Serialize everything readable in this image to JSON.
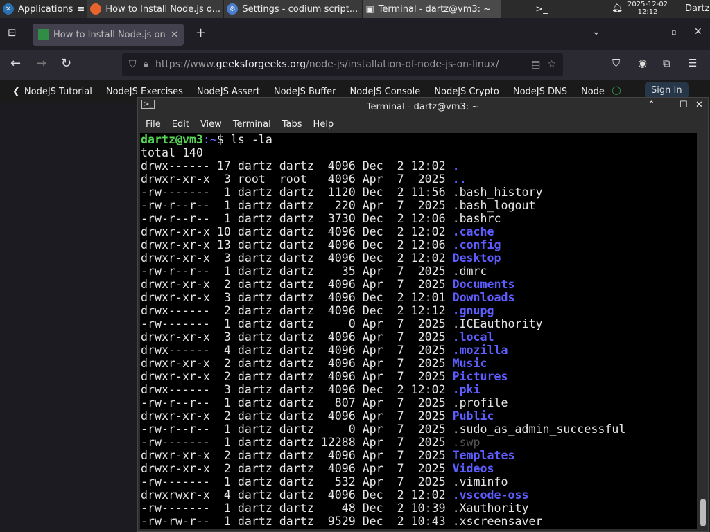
{
  "taskbar": {
    "apps_label": "Applications",
    "windows": [
      "How to Install Node.js o...",
      "Settings - codium script...",
      "Terminal - dartz@vm3: ~"
    ],
    "date": "2025-12-02",
    "time": "12:12",
    "user": "Dartz"
  },
  "browser": {
    "tab_title": "How to Install Node.js on",
    "url_prefix": "https://www.",
    "url_domain": "geeksforgeeks.org",
    "url_path": "/node-js/installation-of-node-js-on-linux/",
    "bookmarks": [
      "NodeJS Tutorial",
      "NodeJS Exercises",
      "NodeJS Assert",
      "NodeJS Buffer",
      "NodeJS Console",
      "NodeJS Crypto",
      "NodeJS DNS",
      "Node"
    ],
    "sign_in": "Sign In"
  },
  "terminal": {
    "title": "Terminal - dartz@vm3: ~",
    "menu": [
      "File",
      "Edit",
      "View",
      "Terminal",
      "Tabs",
      "Help"
    ],
    "prompt_user": "dartz@vm3",
    "prompt_path": ":~",
    "prompt_sym": "$ ",
    "command": "ls -la",
    "total": "total 140",
    "entries": [
      {
        "meta": "drwx------ 17 dartz dartz  4096 Dec  2 12:02 ",
        "name": ".",
        "type": "dir"
      },
      {
        "meta": "drwxr-xr-x  3 root  root   4096 Apr  7  2025 ",
        "name": "..",
        "type": "dir"
      },
      {
        "meta": "-rw-------  1 dartz dartz  1120 Dec  2 11:56 ",
        "name": ".bash_history",
        "type": "file"
      },
      {
        "meta": "-rw-r--r--  1 dartz dartz   220 Apr  7  2025 ",
        "name": ".bash_logout",
        "type": "file"
      },
      {
        "meta": "-rw-r--r--  1 dartz dartz  3730 Dec  2 12:06 ",
        "name": ".bashrc",
        "type": "file"
      },
      {
        "meta": "drwxr-xr-x 10 dartz dartz  4096 Dec  2 12:02 ",
        "name": ".cache",
        "type": "dir"
      },
      {
        "meta": "drwxr-xr-x 13 dartz dartz  4096 Dec  2 12:06 ",
        "name": ".config",
        "type": "dir"
      },
      {
        "meta": "drwxr-xr-x  3 dartz dartz  4096 Dec  2 12:02 ",
        "name": "Desktop",
        "type": "dir"
      },
      {
        "meta": "-rw-r--r--  1 dartz dartz    35 Apr  7  2025 ",
        "name": ".dmrc",
        "type": "file"
      },
      {
        "meta": "drwxr-xr-x  2 dartz dartz  4096 Apr  7  2025 ",
        "name": "Documents",
        "type": "dir"
      },
      {
        "meta": "drwxr-xr-x  3 dartz dartz  4096 Dec  2 12:01 ",
        "name": "Downloads",
        "type": "dir"
      },
      {
        "meta": "drwx------  2 dartz dartz  4096 Dec  2 12:12 ",
        "name": ".gnupg",
        "type": "dir"
      },
      {
        "meta": "-rw-------  1 dartz dartz     0 Apr  7  2025 ",
        "name": ".ICEauthority",
        "type": "file"
      },
      {
        "meta": "drwxr-xr-x  3 dartz dartz  4096 Apr  7  2025 ",
        "name": ".local",
        "type": "dir"
      },
      {
        "meta": "drwx------  4 dartz dartz  4096 Apr  7  2025 ",
        "name": ".mozilla",
        "type": "dir"
      },
      {
        "meta": "drwxr-xr-x  2 dartz dartz  4096 Apr  7  2025 ",
        "name": "Music",
        "type": "dir"
      },
      {
        "meta": "drwxr-xr-x  2 dartz dartz  4096 Apr  7  2025 ",
        "name": "Pictures",
        "type": "dir"
      },
      {
        "meta": "drwx------  3 dartz dartz  4096 Dec  2 12:02 ",
        "name": ".pki",
        "type": "dir"
      },
      {
        "meta": "-rw-r--r--  1 dartz dartz   807 Apr  7  2025 ",
        "name": ".profile",
        "type": "file"
      },
      {
        "meta": "drwxr-xr-x  2 dartz dartz  4096 Apr  7  2025 ",
        "name": "Public",
        "type": "dir"
      },
      {
        "meta": "-rw-r--r--  1 dartz dartz     0 Apr  7  2025 ",
        "name": ".sudo_as_admin_successful",
        "type": "file"
      },
      {
        "meta": "-rw-------  1 dartz dartz 12288 Apr  7  2025 ",
        "name": ".swp",
        "type": "dim"
      },
      {
        "meta": "drwxr-xr-x  2 dartz dartz  4096 Apr  7  2025 ",
        "name": "Templates",
        "type": "dir"
      },
      {
        "meta": "drwxr-xr-x  2 dartz dartz  4096 Apr  7  2025 ",
        "name": "Videos",
        "type": "dir"
      },
      {
        "meta": "-rw-------  1 dartz dartz   532 Apr  7  2025 ",
        "name": ".viminfo",
        "type": "file"
      },
      {
        "meta": "drwxrwxr-x  4 dartz dartz  4096 Dec  2 12:02 ",
        "name": ".vscode-oss",
        "type": "dir"
      },
      {
        "meta": "-rw-------  1 dartz dartz    48 Dec  2 10:39 ",
        "name": ".Xauthority",
        "type": "file"
      },
      {
        "meta": "-rw-rw-r--  1 dartz dartz  9529 Dec  2 10:43 ",
        "name": ".xscreensaver",
        "type": "file"
      }
    ]
  }
}
